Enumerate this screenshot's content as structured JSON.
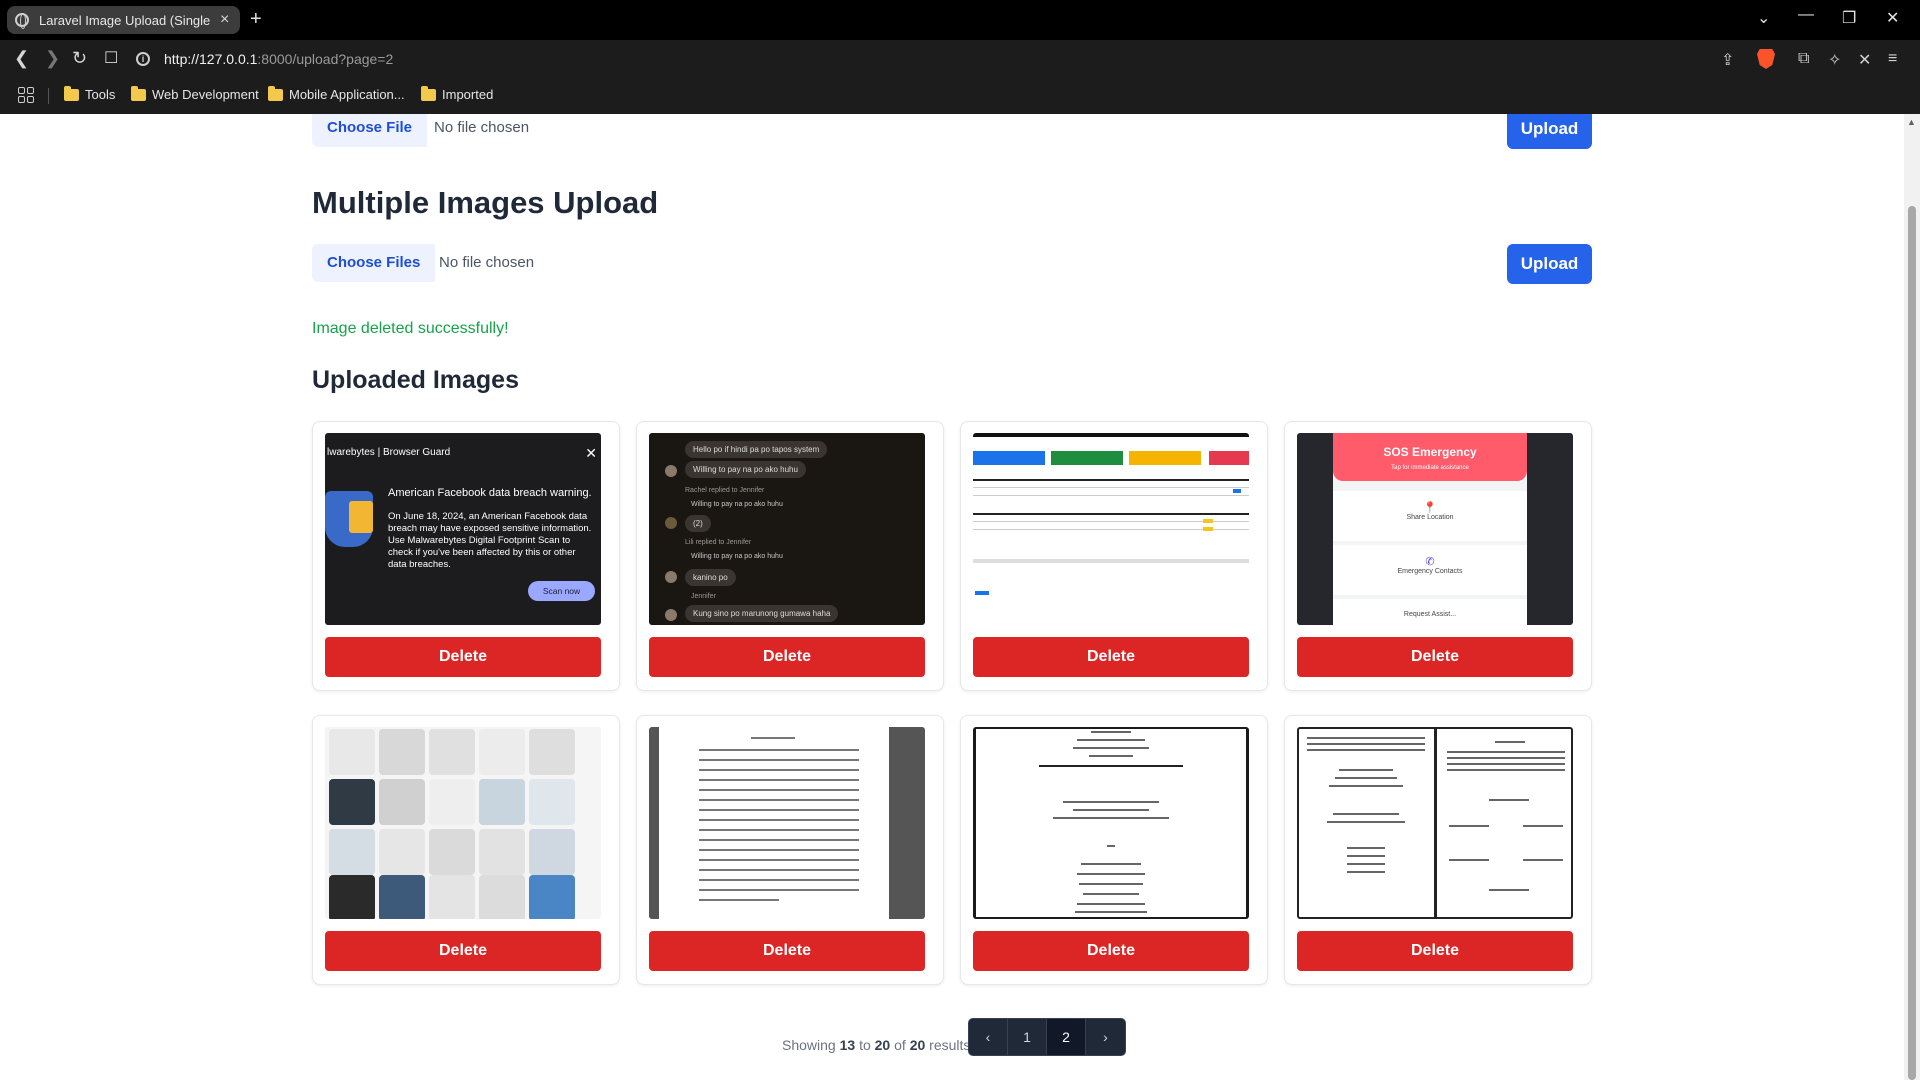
{
  "browser": {
    "tab_title": "Laravel Image Upload (Single + Multiple)",
    "tab_close": "×",
    "new_tab": "+",
    "url_host": "http://127.0.0.1",
    "url_path": ":8000/upload?page=2",
    "bookmarks": [
      "Tools",
      "Web Development",
      "Mobile Application...",
      "Imported"
    ]
  },
  "single_upload": {
    "choose_label": "Choose File",
    "status": "No file chosen",
    "upload_label": "Upload"
  },
  "multiple_upload": {
    "heading": "Multiple Images Upload",
    "choose_label": "Choose Files",
    "status": "No file chosen",
    "upload_label": "Upload"
  },
  "flash": {
    "message": "Image deleted successfully!"
  },
  "gallery": {
    "heading": "Uploaded Images",
    "delete_label": "Delete",
    "thumbnails": {
      "malwarebytes": {
        "brand": "lwarebytes | Browser Guard",
        "title": "American Facebook data breach warning.",
        "body": "On June 18, 2024, an American Facebook data breach may have exposed sensitive information. Use Malwarebytes Digital Footprint Scan to check if you've been affected by this or other data breaches.",
        "cta": "Scan now"
      },
      "chat": {
        "m1": "Hello po if hindi pa po tapos system",
        "m2": "Willing to pay na po ako huhu",
        "meta1": "Rachel replied to Jennifer",
        "m3": "Willing to pay na po ako huhu",
        "m4": "(2)",
        "meta2": "Lili replied to Jennifer",
        "m5": "Willing to pay na po ako huhu",
        "m6": "kanino po",
        "meta3": "Jennifer",
        "m7": "Kung sino po marunong gumawa haha"
      },
      "sos": {
        "title": "SOS Emergency",
        "subtitle": "Tap for immediate assistance",
        "item1": "Share Location",
        "item2": "Emergency Contacts",
        "item3": "Request Assist..."
      }
    }
  },
  "pagination": {
    "prefix": "Showing",
    "from": "13",
    "to_word": "to",
    "to": "20",
    "of_word": "of",
    "total": "20",
    "suffix": "results",
    "prev": "‹",
    "pages": [
      "1",
      "2"
    ],
    "next": "›"
  }
}
